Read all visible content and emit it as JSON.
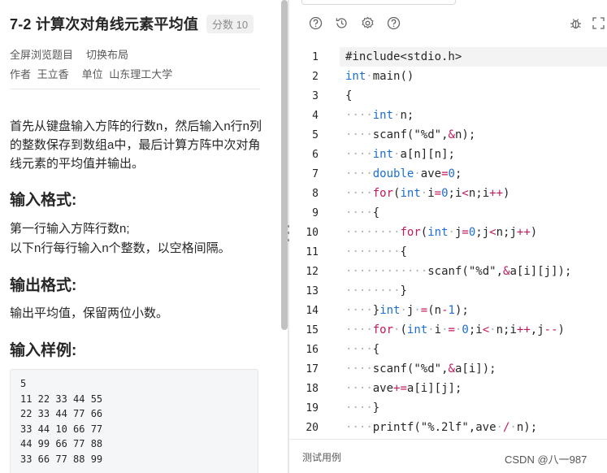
{
  "problem": {
    "title": "7-2 计算次对角线元素平均值",
    "score": "分数 10",
    "links": [
      "全屏浏览题目",
      "切换布局"
    ],
    "author_label": "作者",
    "author": "王立香",
    "unit_label": "单位",
    "unit": "山东理工大学",
    "description": "首先从键盘输入方阵的行数n，然后输入n行n列的整数保存到数组a中，最后计算方阵中次对角线元素的平均值并输出。",
    "input_heading": "输入格式:",
    "input_lines": [
      "第一行输入方阵行数n;",
      "以下n行每行输入n个整数，以空格间隔。"
    ],
    "output_heading": "输出格式:",
    "output_text": "输出平均值，保留两位小数。",
    "sample_heading": "输入样例:",
    "sample_lines": [
      "5",
      "11 22 33 44 55",
      "22 33 44 77 66",
      "33 44 10 66 77",
      "44 99 66 77 88",
      "33 66 77 88 99"
    ]
  },
  "editor": {
    "toolbar_icons": [
      "help-icon",
      "history-icon",
      "settings-icon",
      "question-icon"
    ],
    "toolbar_right_icons": [
      "debug-icon",
      "fullscreen-icon"
    ],
    "line_numbers": [
      "1",
      "2",
      "3",
      "4",
      "5",
      "6",
      "7",
      "8",
      "9",
      "10",
      "11",
      "12",
      "13",
      "14",
      "15",
      "16",
      "17",
      "18",
      "19",
      "20"
    ],
    "lines": [
      "#include<stdio.h>",
      "int main()",
      "{",
      "    int n;",
      "    scanf(\"%d\",&n);",
      "    int a[n][n];",
      "    double ave=0;",
      "    for(int i=0;i<n;i++)",
      "    {",
      "        for(int j=0;j<n;j++)",
      "        {",
      "            scanf(\"%d\",&a[i][j]);",
      "        }",
      "    }int j =(n-1);",
      "    for (int i = 0;i< n;i++,j--)",
      "    {",
      "    scanf(\"%d\",&a[i]);",
      "    ave+=a[i][j];",
      "    }",
      "    printf(\"%.2lf\",ave / n);"
    ],
    "test_label": "测试用例",
    "watermark": "CSDN @八一987"
  },
  "colors": {
    "keyword": "#1a6fd4",
    "control": "#c3195d",
    "string": "#262626",
    "number": "#1a6fd4",
    "whitespace_dot": "#b0b0b0"
  }
}
